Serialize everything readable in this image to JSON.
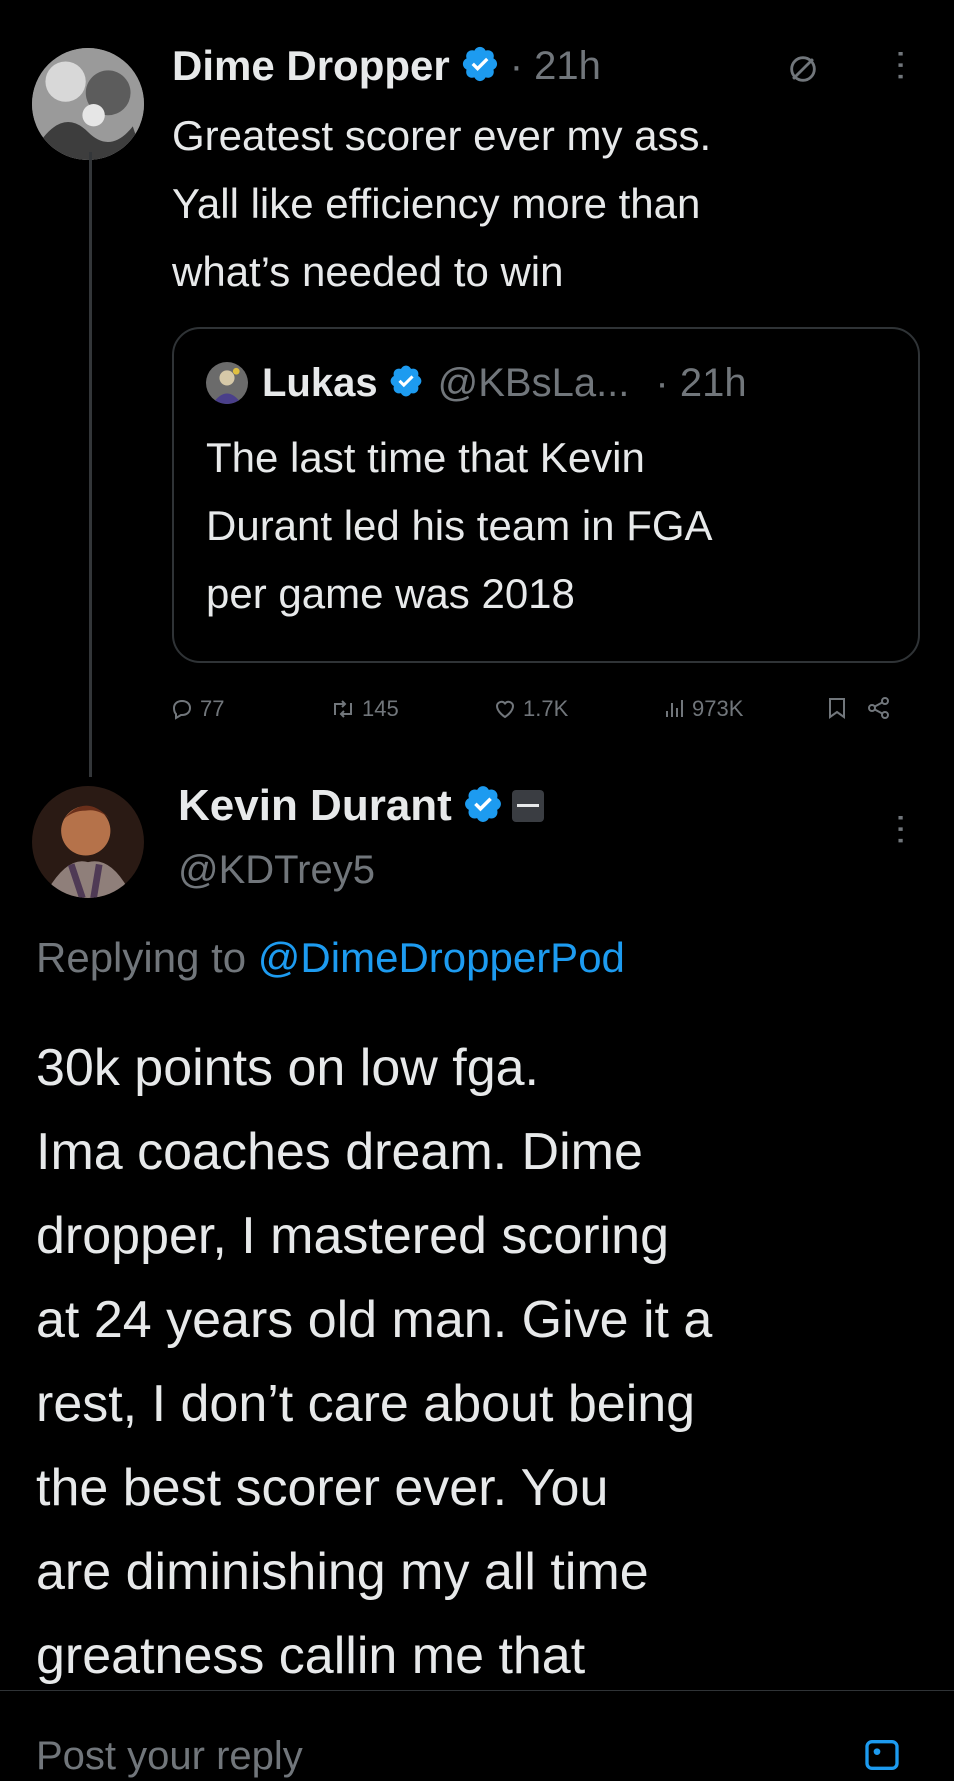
{
  "tweet1": {
    "author": "Dime Dropper",
    "time": "· 21h",
    "text_lines": [
      "Greatest scorer ever my ass.",
      "Yall like efficiency more than",
      "what’s needed to win"
    ],
    "quote": {
      "author": "Lukas",
      "handle": "@KBsLa...",
      "time": "· 21h",
      "text_lines": [
        "The last time that Kevin",
        "Durant led his team in FGA",
        "per game was 2018"
      ]
    },
    "actions": {
      "replies": "77",
      "reposts": "145",
      "likes": "1.7K",
      "views": "973K"
    }
  },
  "tweet2": {
    "author": "Kevin Durant",
    "handle": "@KDTrey5",
    "replying_prefix": "Replying to",
    "replying_handle": "@DimeDropperPod",
    "text_lines": [
      "30k points on low fga.",
      "Ima coaches dream. Dime",
      "dropper, I mastered scoring",
      "at 24 years old man. Give it a",
      "rest, I don’t care about being",
      "the best scorer ever. You",
      "are diminishing my all time",
      "greatness callin me that"
    ]
  },
  "reply_box": {
    "placeholder": "Post your reply"
  },
  "colors": {
    "background": "#000000",
    "text": "#e7e9ea",
    "muted": "#71767b",
    "accent": "#1d9bf0"
  }
}
